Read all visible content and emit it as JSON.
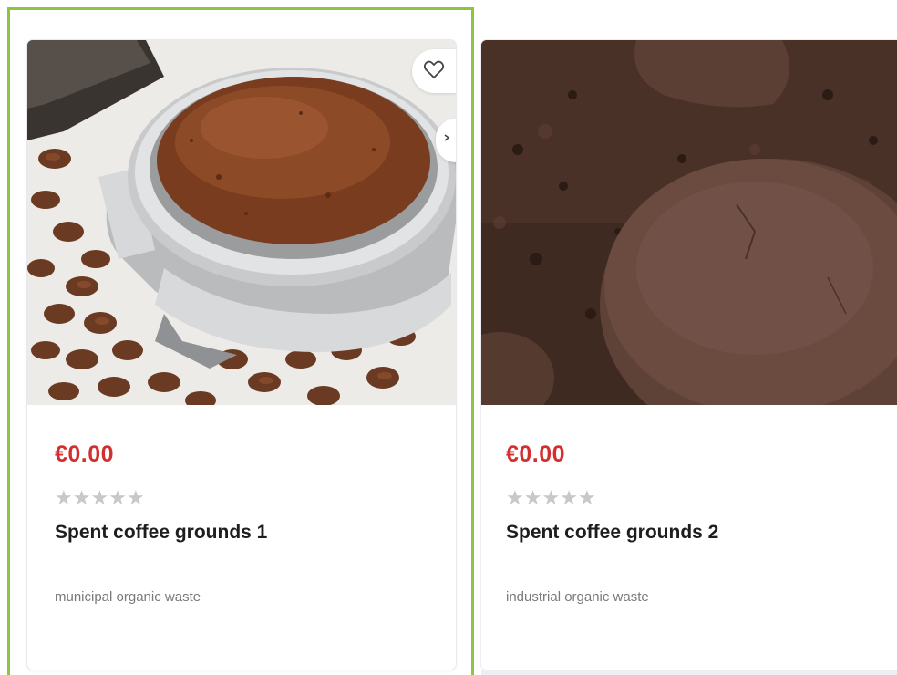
{
  "products": [
    {
      "price": "€0.00",
      "rating": 0,
      "title": "Spent coffee grounds 1",
      "category": "municipal organic waste",
      "image_icon": "portafilter-with-coffee-grounds",
      "wishlist_icon": "heart-icon"
    },
    {
      "price": "€0.00",
      "rating": 0,
      "title": "Spent coffee grounds 2",
      "category": "industrial organic waste",
      "image_icon": "spent-coffee-pucks"
    }
  ],
  "colors": {
    "price": "#d32f2f",
    "highlight_border": "#8cc63f",
    "star_empty": "#c8c8c8"
  }
}
